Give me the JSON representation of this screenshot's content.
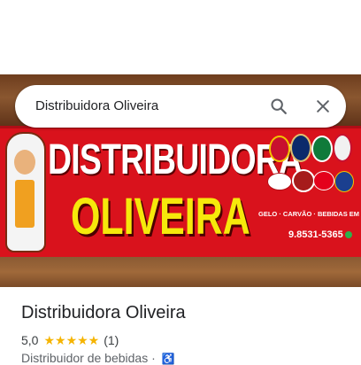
{
  "search": {
    "query": "Distribuidora Oliveira"
  },
  "hero": {
    "line1": "DISTRIBUIDORA",
    "line2": "OLIVEIRA",
    "tagline": "GELO · CARVÃO · BEBIDAS EM GERAL",
    "phone": "9.8531-5365"
  },
  "place": {
    "name": "Distribuidora Oliveira",
    "rating": "5,0",
    "stars": "★★★★★",
    "review_count": "(1)",
    "category": "Distribuidor de bebidas ·"
  },
  "colors": {
    "banner_red": "#d9121c",
    "brand_yellow": "#f6e80b",
    "star": "#f5b400",
    "accessibility": "#1a73e8"
  },
  "icons": {
    "search": "search-icon",
    "close": "close-icon",
    "accessibility": "wheelchair-icon"
  }
}
